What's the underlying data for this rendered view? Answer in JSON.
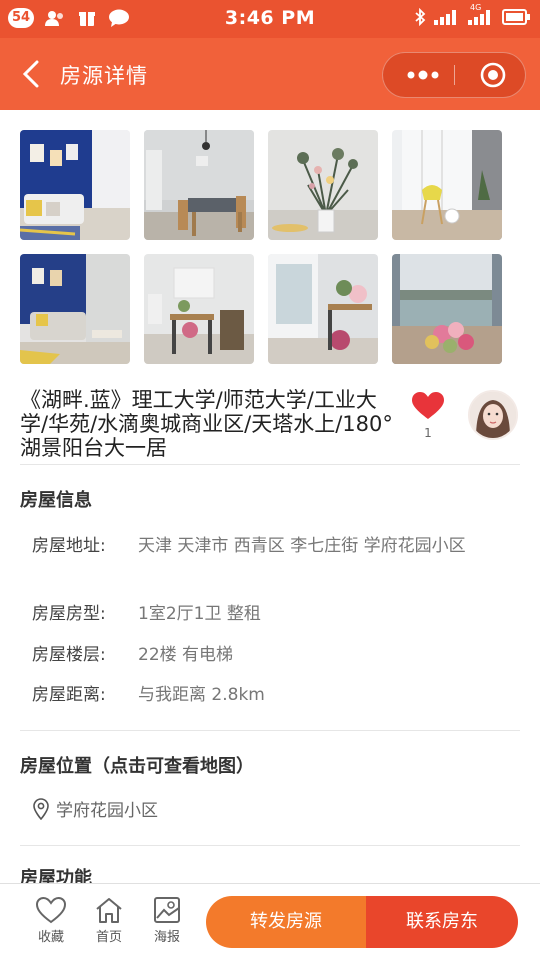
{
  "status_bar": {
    "notification_count": "54",
    "time": "3:46 PM",
    "network": "4G"
  },
  "nav": {
    "title": "房源详情"
  },
  "photos": [
    {
      "name": "photo-living-room-blue-wall"
    },
    {
      "name": "photo-dining-area"
    },
    {
      "name": "photo-flower-vase"
    },
    {
      "name": "photo-balcony-chair"
    },
    {
      "name": "photo-living-room-sofa"
    },
    {
      "name": "photo-dining-table-flowers"
    },
    {
      "name": "photo-window-flowers"
    },
    {
      "name": "photo-lake-view-flowers"
    }
  ],
  "listing": {
    "title": "《湖畔.蓝》理工大学/师范大学/工业大学/华苑/水滴奥城商业区/天塔水上/180°湖景阳台大一居",
    "favorites": "1"
  },
  "house_info": {
    "heading": "房屋信息",
    "rows": [
      {
        "key": "房屋地址:",
        "value": "天津 天津市 西青区 李七庄街 学府花园小区"
      },
      {
        "key": "房屋房型:",
        "value": "1室2厅1卫 整租"
      },
      {
        "key": "房屋楼层:",
        "value": "22楼 有电梯"
      },
      {
        "key": "房屋距离:",
        "value": "与我距离 2.8km"
      }
    ]
  },
  "location": {
    "heading": "房屋位置（点击可查看地图）",
    "place": "学府花园小区"
  },
  "features": {
    "heading": "房屋功能"
  },
  "tabbar": {
    "favorite": "收藏",
    "home": "首页",
    "poster": "海报",
    "share": "转发房源",
    "contact": "联系房东"
  },
  "colors": {
    "status_bar": "#ea5330",
    "nav_bar": "#f1613a",
    "heart": "#e8343a",
    "share_button": "#f37a2b",
    "contact_button": "#e9462b"
  }
}
